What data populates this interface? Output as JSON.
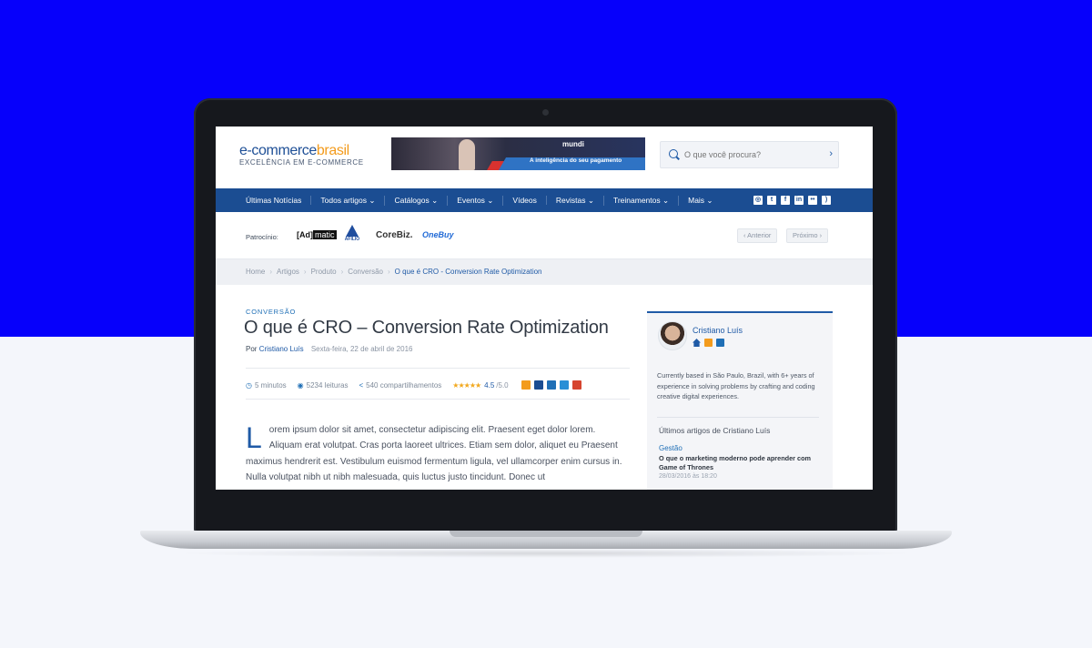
{
  "site": {
    "logo_main": "e-commerce",
    "logo_accent": "brasil",
    "logo_sub": "EXCELÊNCIA EM E-COMMERCE"
  },
  "banner": {
    "brand": "mundi",
    "tagline": "A inteligência do seu pagamento"
  },
  "search": {
    "placeholder": "O que você procura?"
  },
  "nav": {
    "items": [
      "Últimas Notícias",
      "Todos artigos ⌄",
      "Catálogos ⌄",
      "Eventos ⌄",
      "Vídeos",
      "Revistas ⌄",
      "Treinamentos ⌄",
      "Mais ⌄"
    ],
    "social_icons": [
      "instagram-icon",
      "twitter-icon",
      "facebook-icon",
      "linkedin-icon",
      "flickr-icon",
      "rss-icon"
    ]
  },
  "sponsors": {
    "label": "Patrocínio:",
    "admatic_a": "[Ad]",
    "admatic_b": "matic",
    "afilio": "AFILIO",
    "corebiz": "CoreBiz.",
    "onebuy": "OneBuy"
  },
  "pager": {
    "prev": "‹ Anterior",
    "next": "Próximo ›"
  },
  "breadcrumb": [
    "Home",
    "Artigos",
    "Produto",
    "Conversão",
    "O que é CRO - Conversion Rate Optimization"
  ],
  "article": {
    "category": "CONVERSÃO",
    "title": "O que é CRO – Conversion Rate Optimization",
    "by": "Por",
    "author": "Cristiano Luís",
    "date": "Sexta-feira, 22 de abril de 2016",
    "read_time": "5 minutos",
    "reads": "5234 leituras",
    "shares": "540 compartilhamentos",
    "stars": "★★★★★",
    "rating": "4.5",
    "rating_max": "/5.0",
    "dropcap": "L",
    "body": "orem ipsum dolor sit amet, consectetur adipiscing elit. Praesent eget dolor lorem. Aliquam erat volutpat. Cras porta laoreet ultrices. Etiam sem dolor, aliquet eu Praesent maximus hendrerit est. Vestibulum euismod fermentum ligula, vel ullamcorper enim cursus in. Nulla volutpat nibh ut nibh malesuada, quis luctus justo tincidunt. Donec ut"
  },
  "colors": {
    "accent": "#1f5aa6",
    "nav_bg": "#1b4d92",
    "background_top": "#0600fb"
  },
  "sidebar": {
    "author_name": "Cristiano Luís",
    "bio": "Currently based in São Paulo, Brazil, with 6+ years of experience in solving problems by crafting and coding creative digital experiences.",
    "latest_heading": "Últimos artigos de Cristiano Luís",
    "latest_category": "Gestão",
    "latest_title": "O que o marketing moderno pode aprender com Game of Thrones",
    "latest_date": "28/03/2016 às 18:20"
  }
}
